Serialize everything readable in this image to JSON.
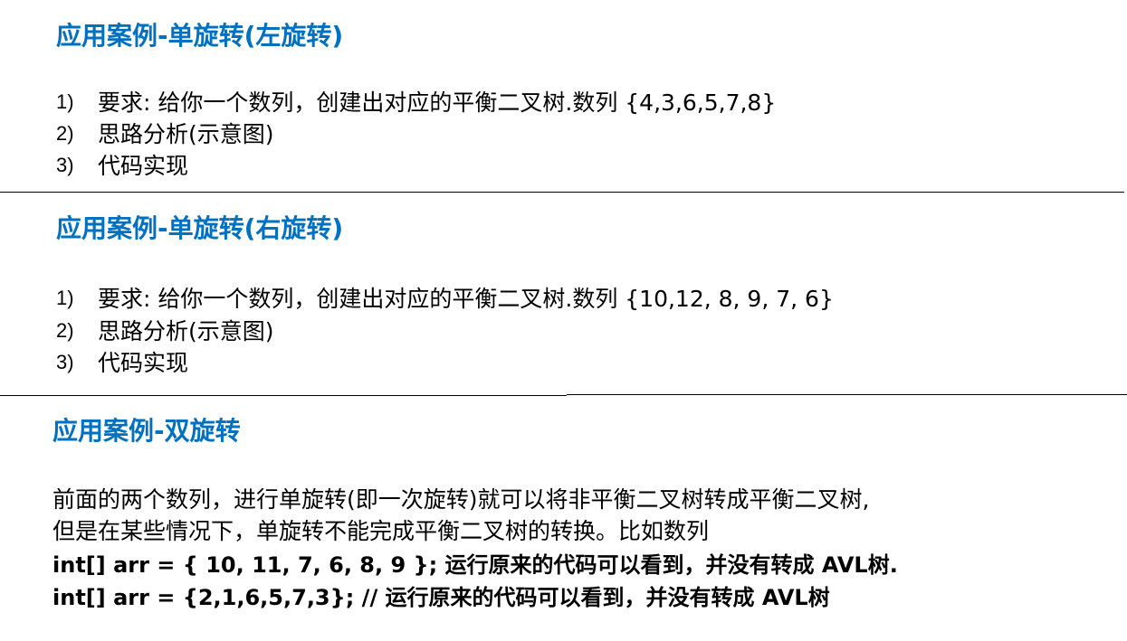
{
  "theme": {
    "title_color": "#0070c0"
  },
  "sections": [
    {
      "title": "应用案例-单旋转(左旋转)",
      "items": [
        {
          "num": "1)",
          "text": "要求: 给你一个数列，创建出对应的平衡二叉树.数列 {4,3,6,5,7,8}"
        },
        {
          "num": "2)",
          "text": "思路分析(示意图)"
        },
        {
          "num": "3)",
          "text": "代码实现"
        }
      ]
    },
    {
      "title": "应用案例-单旋转(右旋转)",
      "items": [
        {
          "num": "1)",
          "text": "要求: 给你一个数列，创建出对应的平衡二叉树.数列 {10,12, 8, 9, 7, 6}"
        },
        {
          "num": "2)",
          "text": "思路分析(示意图)"
        },
        {
          "num": "3)",
          "text": "代码实现"
        }
      ]
    },
    {
      "title": "应用案例-双旋转",
      "paragraph": [
        "前面的两个数列，进行单旋转(即一次旋转)就可以将非平衡二叉树转成平衡二叉树,",
        "但是在某些情况下，单旋转不能完成平衡二叉树的转换。比如数列"
      ],
      "code_lines": [
        "int[] arr = { 10, 11, 7, 6, 8, 9 };  运行原来的代码可以看到，并没有转成 AVL树.",
        "int[] arr = {2,1,6,5,7,3}; // 运行原来的代码可以看到，并没有转成 AVL树"
      ]
    }
  ]
}
